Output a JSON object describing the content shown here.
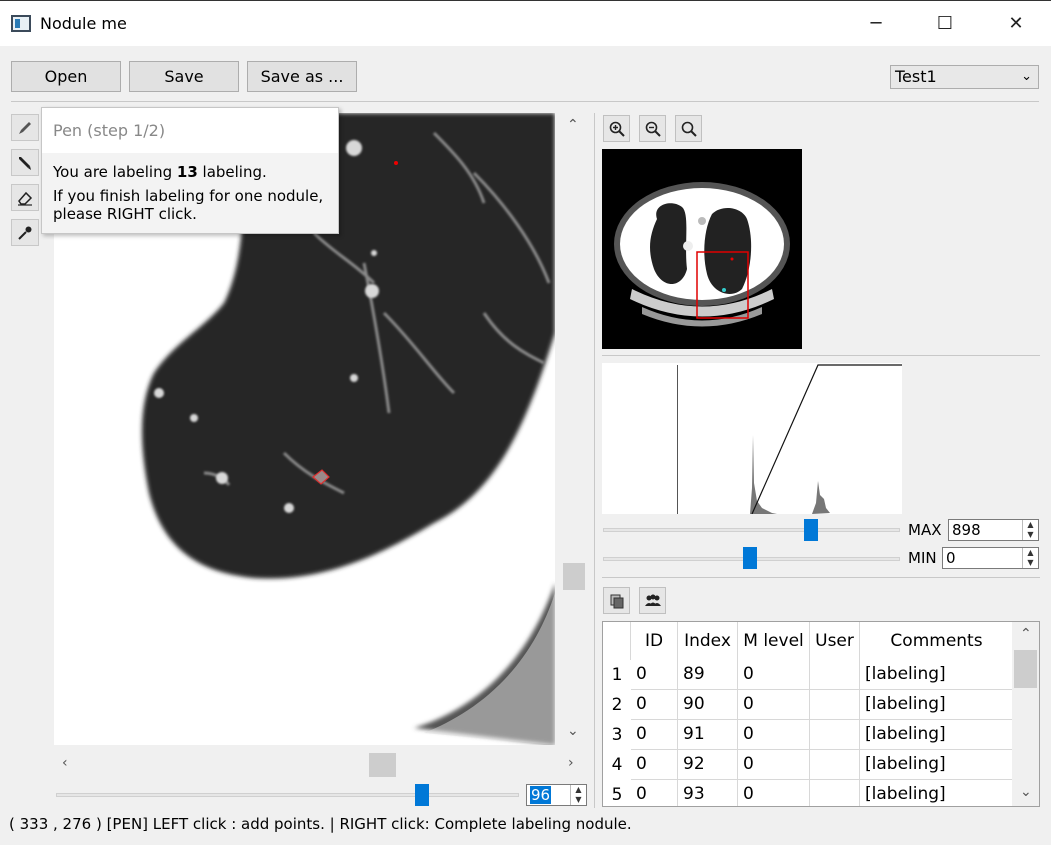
{
  "window": {
    "title": "Nodule me",
    "minimize": "─",
    "maximize": "☐",
    "close": "✕"
  },
  "toolbar": {
    "open": "Open",
    "save": "Save",
    "save_as": "Save as ...",
    "dataset": "Test1"
  },
  "tools": [
    "pen-icon",
    "brush-icon",
    "eraser-icon",
    "eyedropper-icon"
  ],
  "tooltip": {
    "title": "Pen (step 1/2)",
    "line1_prefix": "You are labeling ",
    "line1_count": "13",
    "line1_suffix": " labeling.",
    "line2": "If you finish labeling for one nodule, please RIGHT click."
  },
  "viewer": {
    "slice_value": "96",
    "slice_max": 120
  },
  "zoom_buttons": [
    "zoom-in-icon",
    "zoom-out-icon",
    "zoom-fit-icon"
  ],
  "window_level": {
    "max_label": "MAX",
    "max_value": "898",
    "min_label": "MIN",
    "min_value": "0",
    "max_fraction": 0.71,
    "min_fraction": 0.495
  },
  "table": {
    "icons": [
      "copy-icon",
      "users-icon"
    ],
    "columns": [
      "ID",
      "Index",
      "M level",
      "User",
      "Comments"
    ],
    "rows": [
      {
        "num": "1",
        "id": "0",
        "index": "89",
        "mlevel": "0",
        "user": "",
        "comments": "[labeling]"
      },
      {
        "num": "2",
        "id": "0",
        "index": "90",
        "mlevel": "0",
        "user": "",
        "comments": "[labeling]"
      },
      {
        "num": "3",
        "id": "0",
        "index": "91",
        "mlevel": "0",
        "user": "",
        "comments": "[labeling]"
      },
      {
        "num": "4",
        "id": "0",
        "index": "92",
        "mlevel": "0",
        "user": "",
        "comments": "[labeling]"
      },
      {
        "num": "5",
        "id": "0",
        "index": "93",
        "mlevel": "0",
        "user": "",
        "comments": "[labeling]"
      }
    ]
  },
  "status": "( 333 , 276 )  [PEN] LEFT click : add points. | RIGHT click: Complete labeling nodule."
}
